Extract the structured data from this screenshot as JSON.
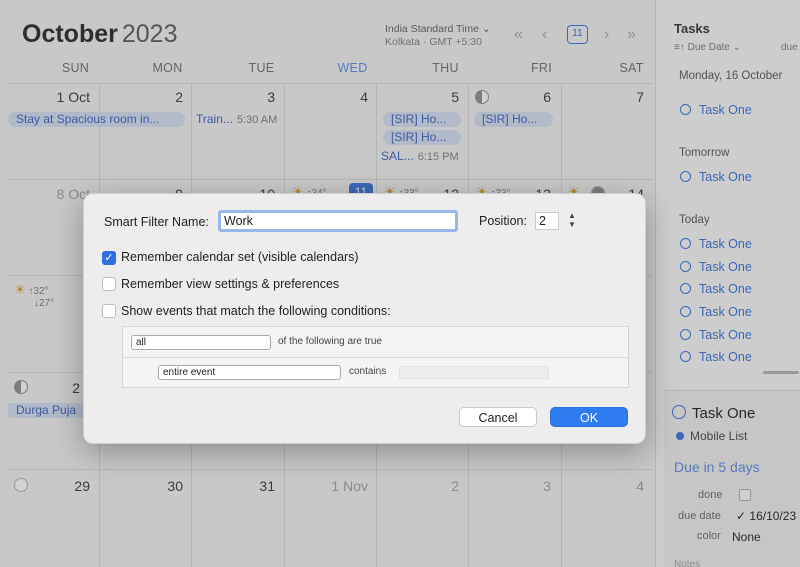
{
  "calendar": {
    "month": "October",
    "year": "2023",
    "timezone": {
      "name": "India Standard Time ⌄",
      "detail": "Kolkata · GMT +5:30"
    },
    "nav": {
      "first": "«",
      "prev": "‹",
      "today": "11",
      "next": "›",
      "last": "»"
    },
    "weekdays": [
      "SUN",
      "MON",
      "TUE",
      "WED",
      "THU",
      "FRI",
      "SAT"
    ],
    "row1": [
      "1 Oct",
      "2",
      "3",
      "4",
      "5",
      "6",
      "7"
    ],
    "row2": [
      "8 Oct",
      "9",
      "10",
      "11",
      "12",
      "13",
      "14"
    ],
    "row5": [
      "29",
      "30",
      "31",
      "1 Nov",
      "2",
      "3",
      "4"
    ],
    "row4_first": "2",
    "events": {
      "stay": "Stay at Spacious room in...",
      "train": "Train...",
      "train_time": "5:30 AM",
      "sir1": "[SIR] Ho...",
      "sir2": "[SIR] Ho...",
      "sir3": "[SIR] Ho...",
      "sal": "SAL...",
      "sal_time": "6:15 PM",
      "durga": "Durga Puja"
    },
    "weather": {
      "w1": "↑34°",
      "w2": "↑33°",
      "w3": "↑33°",
      "w4": "↑32°",
      "w4b": "↓27°"
    }
  },
  "tasks": {
    "title": "Tasks",
    "sort_label": "≡↑ Due Date ⌄",
    "sort_right": "due",
    "groups": [
      {
        "label": "Monday, 16 October",
        "items": [
          "Task One"
        ]
      },
      {
        "label": "Tomorrow",
        "items": [
          "Task One"
        ]
      },
      {
        "label": "Today",
        "items": [
          "Task One",
          "Task One",
          "Task One",
          "Task One",
          "Task One",
          "Task One"
        ]
      }
    ],
    "detail": {
      "title": "Task One",
      "list": "Mobile List",
      "due_text": "Due in 5 days",
      "done_label": "done",
      "due_date_label": "due date",
      "due_date_value": "16/10/23",
      "color_label": "color",
      "color_value": "None",
      "notes_label": "Notes"
    }
  },
  "dialog": {
    "name_label": "Smart Filter Name:",
    "name_value": "Work",
    "position_label": "Position:",
    "position_value": "2",
    "opt1": "Remember calendar set (visible calendars)",
    "opt1_checked": true,
    "opt2": "Remember view settings & preferences",
    "opt3": "Show events that match the following conditions:",
    "cond_all": "all",
    "cond_all_text": "of the following are true",
    "cond_field": "entire event",
    "cond_op": "contains",
    "cancel": "Cancel",
    "ok": "OK"
  },
  "colors": {
    "accent": "#2f7cf0",
    "event": "#4a6fc7",
    "event_bg": "#d9e3f6"
  }
}
